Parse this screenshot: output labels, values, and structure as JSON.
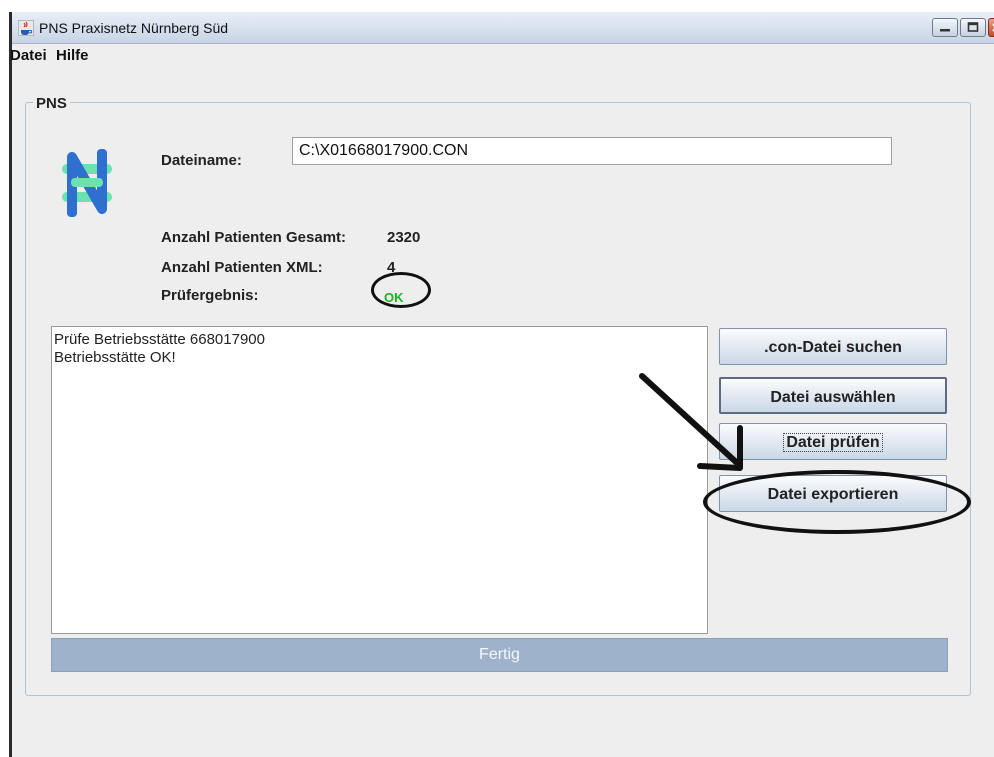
{
  "window": {
    "title": "PNS Praxisnetz Nürnberg Süd"
  },
  "menu": {
    "items": [
      "Datei",
      "Hilfe"
    ]
  },
  "panel": {
    "title": "PNS",
    "dateiname_label": "Dateiname:",
    "dateiname_value": "C:\\X01668017900.CON",
    "patienten_gesamt_label": "Anzahl Patienten Gesamt:",
    "patienten_gesamt_value": "2320",
    "patienten_xml_label": "Anzahl Patienten XML:",
    "patienten_xml_value": "4",
    "pruefergebnis_label": "Prüfergebnis:",
    "pruefergebnis_value": "OK"
  },
  "log": {
    "lines": [
      "Prüfe Betriebsstätte 668017900",
      "Betriebsstätte OK!"
    ]
  },
  "buttons": {
    "con_suchen": ".con-Datei suchen",
    "auswaehlen": "Datei auswählen",
    "pruefen": "Datei prüfen",
    "exportieren": "Datei exportieren"
  },
  "status": {
    "fertig": "Fertig"
  },
  "colors": {
    "ok_green": "#1fb51f",
    "progress_bar": "#9eb3cb",
    "panel_border": "#a9c4db"
  },
  "icons": {
    "app_icon": "java-cup-icon",
    "logo": "pns-logo-icon"
  }
}
